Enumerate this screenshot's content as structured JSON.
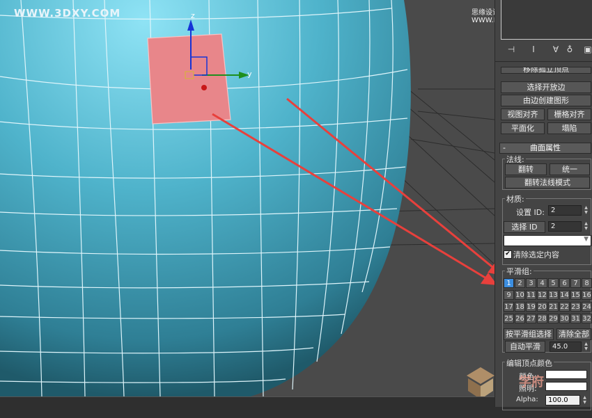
{
  "watermarks": {
    "top_left": "WWW.3DXY.COM",
    "top_right": "思缘设计论坛 WWW.MISSYUAN.COM",
    "bottom_logo": "学府"
  },
  "gizmo": {
    "z_label": "z",
    "y_label": "y"
  },
  "toolbar": {
    "icons": [
      "pin-icon",
      "pipe-icon",
      "funnel-icon",
      "trash-icon",
      "config-icon"
    ]
  },
  "edit_geometry": {
    "buttons": {
      "partial_top": "移除孤立顶点",
      "select_open_edges": "选择开放边",
      "create_shape_from_edges": "由边创建图形",
      "view_align": "视图对齐",
      "grid_align": "栅格对齐",
      "planarize": "平面化",
      "collapse": "塌陷"
    }
  },
  "surface_properties": {
    "title": "曲面属性",
    "collapse_symbol": "-",
    "normals": {
      "group_label": "法线:",
      "flip": "翻转",
      "unify": "统一",
      "flip_normal_mode": "翻转法线模式"
    },
    "material": {
      "group_label": "材质:",
      "set_id_label": "设置 ID:",
      "set_id_value": "2",
      "select_id_button": "选择 ID",
      "select_id_value": "2",
      "dropdown_value": "",
      "clear_selection_label": "清除选定内容",
      "clear_selection_checked": true
    },
    "smoothing_groups": {
      "group_label": "平滑组:",
      "numbers": [
        "1",
        "2",
        "3",
        "4",
        "5",
        "6",
        "7",
        "8",
        "9",
        "10",
        "11",
        "12",
        "13",
        "14",
        "15",
        "16",
        "17",
        "18",
        "19",
        "20",
        "21",
        "22",
        "23",
        "24",
        "25",
        "26",
        "27",
        "28",
        "29",
        "30",
        "31",
        "32"
      ],
      "active": "1",
      "select_by_sg": "按平滑组选择",
      "clear_all": "清除全部",
      "auto_smooth": "自动平滑",
      "auto_smooth_value": "45.0"
    },
    "edit_vertex_colors": {
      "group_label": "编辑顶点颜色",
      "color_label": "颜色:",
      "illumination_label": "照明:",
      "alpha_label": "Alpha:",
      "alpha_value": "100.0"
    }
  },
  "colors": {
    "sphere": "#4aa3bd",
    "selected_face": "#e8868a",
    "arrow": "#e8403c",
    "active_smoothing_group": "#3c8ee0"
  }
}
